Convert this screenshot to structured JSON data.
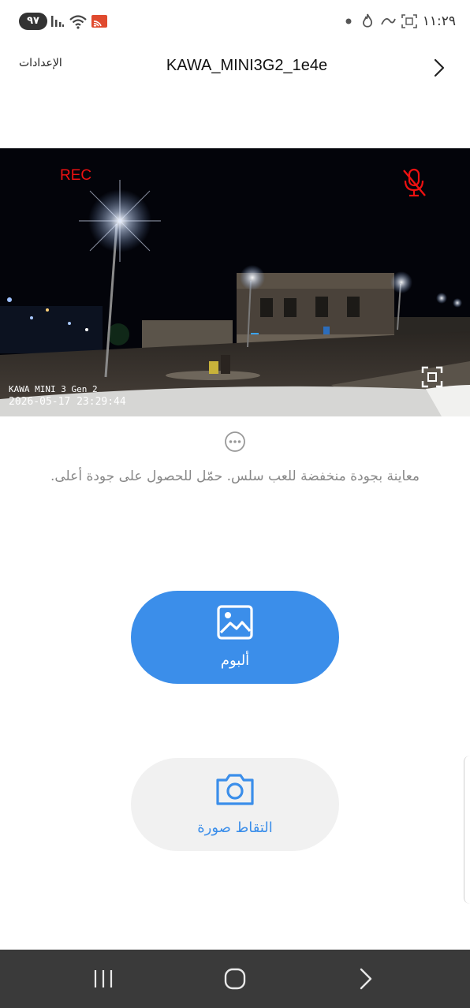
{
  "status_bar": {
    "battery": "٩٧",
    "time": "١١:٢٩"
  },
  "header": {
    "settings_label": "الإعدادات",
    "device_name": "KAWA_MINI3G2_1e4e"
  },
  "video": {
    "rec_label": "REC",
    "osd_model": "KAWA MINI 3 Gen 2",
    "osd_datetime": "2026-05-17  23:29:44"
  },
  "preview_hint": "معاينة بجودة منخفضة للعب سلس. حمّل للحصول على جودة أعلى.",
  "actions": {
    "album_label": "ألبوم",
    "capture_label": "التقاط صورة"
  },
  "colors": {
    "accent": "#3b8eea",
    "rec": "#e11111",
    "navbar": "#3a3a3a"
  },
  "icons": [
    "signal-icon",
    "wifi-icon",
    "cast-icon",
    "dot-icon",
    "flame-icon",
    "link-icon",
    "screenshot-icon",
    "chevron-right-icon",
    "mic-off-icon",
    "fullscreen-icon",
    "more-icon",
    "image-icon",
    "camera-icon",
    "recents-icon",
    "home-icon",
    "back-icon"
  ]
}
